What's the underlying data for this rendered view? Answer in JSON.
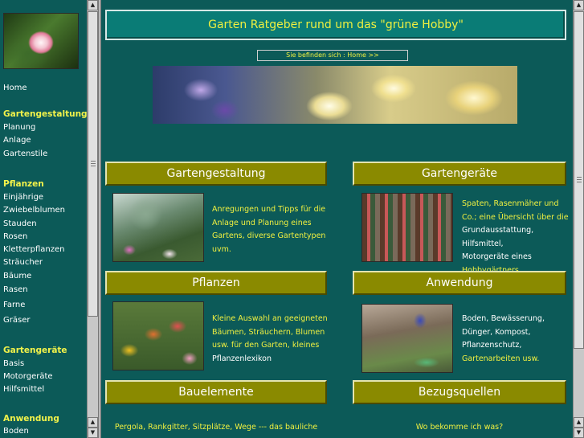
{
  "sidebar": {
    "home": "Home",
    "sections": [
      {
        "heading": "Gartengestaltung",
        "items": [
          "Planung",
          "Anlage",
          "Gartenstile"
        ]
      },
      {
        "heading": "Pflanzen",
        "items": [
          "Einjährige",
          "Zwiebelblumen",
          "Stauden",
          "Rosen",
          "Kletterpflanzen",
          "Sträucher",
          "Bäume",
          "Rasen",
          "Farne",
          "Gräser"
        ]
      },
      {
        "heading": "Gartengeräte",
        "items": [
          "Basis",
          "Motorgeräte",
          "Hilfsmittel"
        ]
      },
      {
        "heading": "Anwendung",
        "items": [
          "Boden"
        ]
      }
    ]
  },
  "header": {
    "title": "Garten Ratgeber rund um das \"grüne Hobby\"",
    "breadcrumb_prefix": "Sie befinden sich :",
    "breadcrumb_link": "Home >>"
  },
  "sections": {
    "gartengestaltung": {
      "title": "Gartengestaltung",
      "desc": [
        "Anregungen und Tipps für die",
        "Anlage und Planung eines",
        "Gartens, diverse Gartentypen",
        "uvm."
      ]
    },
    "gartengeraete": {
      "title": "Gartengeräte",
      "desc": [
        "Spaten, Rasenmäher und",
        "Co.; eine Übersicht über die",
        "Grundausstattung, Hilfsmittel,",
        "Motorgeräte eines",
        "Hobbygärtners"
      ]
    },
    "pflanzen": {
      "title": "Pflanzen",
      "desc": [
        "Kleine Auswahl an geeigneten",
        "Bäumen, Sträuchern, Blumen",
        "usw. für den Garten, kleines",
        "Pflanzenlexikon"
      ]
    },
    "anwendung": {
      "title": "Anwendung",
      "desc": [
        "Boden, Bewässerung,",
        "Dünger, Kompost,",
        "Pflanzenschutz,",
        "Gartenarbeiten usw."
      ]
    },
    "bauelemente": {
      "title": "Bauelemente",
      "desc": "Pergola, Rankgitter, Sitzplätze, Wege --- das bauliche"
    },
    "bezugsquellen": {
      "title": "Bezugsquellen",
      "desc": "Wo bekomme ich was?"
    }
  },
  "colors": {
    "background": "#0c5a58",
    "heading_bar": "#8a8a00",
    "link": "#f0f040",
    "text": "#ffffff"
  }
}
